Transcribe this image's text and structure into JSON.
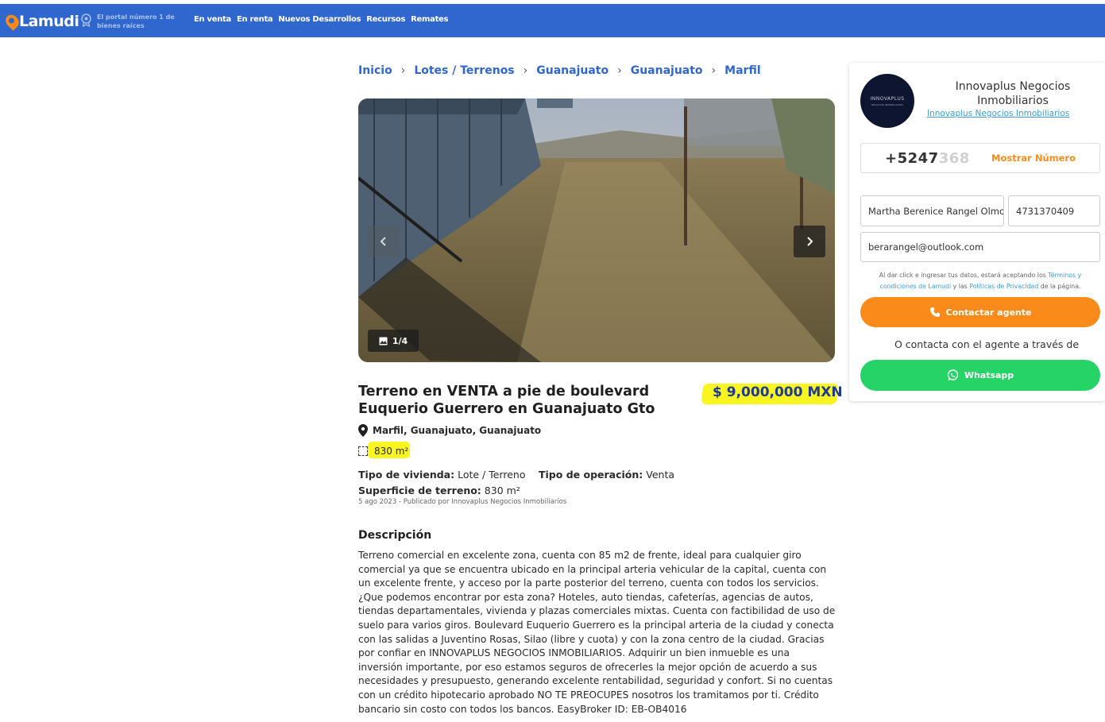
{
  "header": {
    "brand": "Lamudi",
    "slogan": "El portal número 1 de bienes raíces",
    "nav": [
      "En venta",
      "En renta",
      "Nuevos Desarrollos",
      "Recursos",
      "Remates"
    ]
  },
  "breadcrumb": [
    "Inicio",
    "Lotes / Terrenos",
    "Guanajuato",
    "Guanajuato",
    "Marfil"
  ],
  "gallery": {
    "counter": "1/4"
  },
  "listing": {
    "title": "Terreno en VENTA a pie de boulevard Euquerio Guerrero en Guanajuato Gto",
    "price": "$ 9,000,000 MXN",
    "location": "Marfil, Guanajuato, Guanajuato",
    "area": "830 m²",
    "type_label": "Tipo de vivienda:",
    "type_value": "Lote / Terreno",
    "operation_label": "Tipo de operación:",
    "operation_value": "Venta",
    "land_label": "Superficie de terreno:",
    "land_value": "830 m²",
    "published": "5 ago 2023 - Publicado por Innovaplus Negocios Inmobiliarios"
  },
  "description": {
    "heading": "Descripción",
    "text": "Terreno comercial en excelente zona, cuenta con 85 m2 de frente, ideal para cualquier giro comercial ya que se encuentra ubicado en la principal arteria vehicular de la capital, cuenta con un excelente frente, y acceso por la parte posterior del terreno, cuenta con todos los servicios. ¿Que podemos encontrar por esta zona? Hoteles, auto tiendas, cafeterías, agencias de autos, tiendas departamentales, vivienda y plazas comerciales mixtas. Cuenta con factibilidad de uso de suelo para varios giros. Boulevard Euquerio Guerrero es la principal arteria de la ciudad y conecta con las salidas a Juventino Rosas, Silao (libre y cuota) y con la zona centro de la ciudad. Gracias por confiar en INNOVAPLUS NEGOCIOS INMOBILIARIOS. Adquirir un bien inmueble es una inversión importante, por eso estamos seguros de ofrecerles la mejor opción de acuerdo a sus necesidades y presupuesto, generando excelente rentabilidad, seguridad y confort. Si no cuentas con un crédito hipotecario aprobado NO TE PREOCUPES nosotros los tramitamos por ti. Crédito bancario sin costo con todos los bancos. EasyBroker ID: EB-OB4016"
  },
  "agent": {
    "logo_text": "INNOVAPLUS",
    "logo_sub": "NEGOCIOS INMOBILIARIOS",
    "name": "Innovaplus Negocios Inmobiliarios",
    "link": "Innovaplus Negocios Inmobiliarios",
    "phone_visible": "+5247",
    "phone_faded": "368",
    "show_number": "Mostrar Número"
  },
  "form": {
    "name_value": "Martha Berenice Rangel Olmos",
    "phone_value": "4731370409",
    "email_value": "berarangel@outlook.com",
    "terms_pre": "Al dar click e ingresar tus datos, estará aceptando los ",
    "terms_link": "Términos y condiciones de Lamudi",
    "terms_mid": " y las ",
    "privacy_link": "Políticas de Privacidad",
    "terms_post": " de la página.",
    "contact_button": "Contactar agente",
    "contact_via": "O contacta con el agente a través de",
    "whatsapp_button": "Whatsapp"
  },
  "colors": {
    "header_bg": "#3067cf",
    "accent_orange": "#fa8b1a",
    "whatsapp_green": "#25d366",
    "link_blue": "#3a9fdb",
    "highlight_yellow": "#f9f520"
  }
}
